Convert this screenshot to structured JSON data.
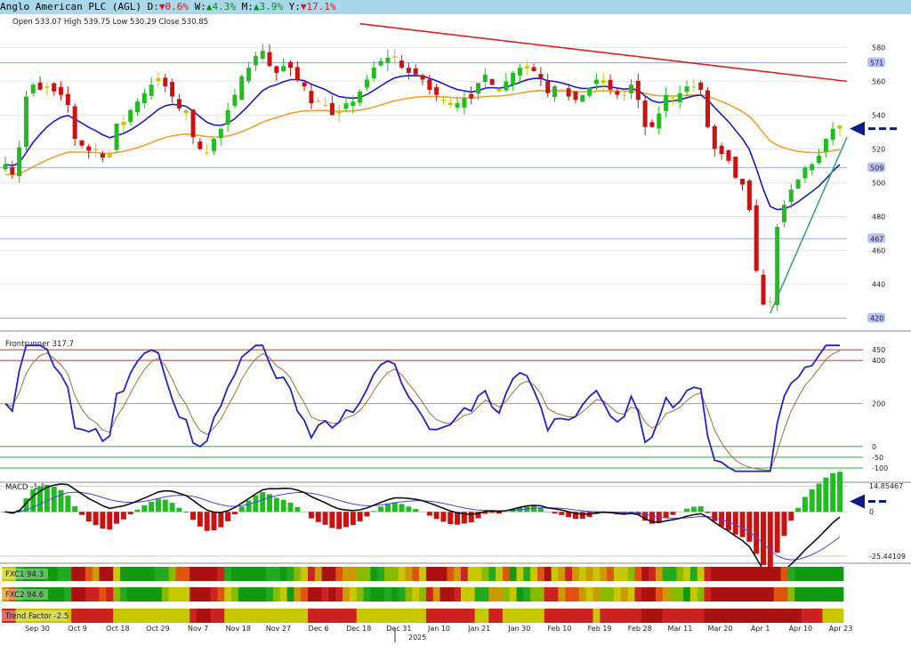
{
  "header": {
    "company": "Anglo American PLC (AGL)",
    "day_label": "D:",
    "day_value": "▼0.6%",
    "week_label": "W:",
    "week_value": "▲4.3%",
    "month_label": "M:",
    "month_value": "▲3.9%",
    "year_label": "Y:",
    "year_value": "▼17.1%"
  },
  "ohlc": "Open 533.07  High 539.75  Low 530.29  Close 530.85",
  "chart_data": {
    "type": "candlestick",
    "price_axis": {
      "ticks": [
        "580",
        "560",
        "540",
        "520",
        "500",
        "480",
        "460",
        "440",
        "420"
      ],
      "values": [
        580,
        560,
        540,
        520,
        500,
        480,
        460,
        440,
        420
      ],
      "ylim": [
        413,
        597
      ]
    },
    "horizontal_levels": [
      {
        "label": "571",
        "value": 571
      },
      {
        "label": "509",
        "value": 509
      },
      {
        "label": "467",
        "value": 467
      },
      {
        "label": "420",
        "value": 420
      }
    ],
    "x_axis_labels": [
      "Sep 30",
      "Oct 9",
      "Oct 18",
      "Oct 29",
      "Nov 7",
      "Nov 18",
      "Nov 27",
      "Dec 6",
      "Dec 18",
      "Dec 31",
      "Jan 10",
      "Jan 21",
      "Jan 30",
      "Feb 10",
      "Feb 19",
      "Feb 28",
      "Mar 11",
      "Mar 20",
      "Apr 1",
      "Apr 10",
      "Apr 23"
    ],
    "year_label": "2025",
    "candles_close": [
      511,
      505,
      521,
      551,
      558,
      555,
      557,
      554,
      552,
      546,
      526,
      522,
      519,
      520,
      515,
      517,
      535,
      536,
      543,
      548,
      553,
      558,
      562,
      557,
      551,
      544,
      541,
      527,
      520,
      518,
      526,
      532,
      543,
      552,
      563,
      568,
      575,
      578,
      569,
      565,
      569,
      568,
      561,
      557,
      547,
      548,
      546,
      540,
      541,
      547,
      548,
      554,
      561,
      568,
      572,
      574,
      574,
      568,
      565,
      564,
      561,
      555,
      552,
      549,
      546,
      547,
      550,
      550,
      559,
      564,
      558,
      554,
      560,
      565,
      568,
      569,
      566,
      562,
      553,
      557,
      555,
      551,
      549,
      552,
      556,
      561,
      559,
      555,
      552,
      552,
      558,
      549,
      533,
      533,
      541,
      552,
      550,
      553,
      557,
      557,
      555,
      533,
      520,
      517,
      513,
      503,
      499,
      484,
      448,
      428,
      430,
      474,
      487,
      496,
      502,
      509,
      511,
      516,
      526,
      532,
      532
    ],
    "ma_blue": {
      "name": "",
      "values_hint": "declining into late April"
    },
    "ma_orange": {
      "name": "",
      "values_hint": "slow rising average"
    },
    "trendlines": [
      "resistance from Jan 21 to Apr 23",
      "support from Apr 7 to Apr 23"
    ],
    "last_price_marker": "530.85",
    "frontrunner": {
      "label": "Frontrunner 317.7",
      "ticks": [
        "450",
        "400",
        "200",
        "0",
        "-50",
        "-100"
      ],
      "values": [
        450,
        400,
        200,
        0,
        -50,
        -100
      ],
      "ylim": [
        -125,
        500
      ]
    },
    "macd": {
      "label": "MACD -1.1",
      "ticks": [
        "14.85467",
        "0",
        "-25.44109"
      ],
      "values": [
        14.85467,
        0,
        -25.44109
      ]
    },
    "heat_strips": [
      {
        "label": "FXC1 94.3"
      },
      {
        "label": "FXC2 94.6"
      },
      {
        "label": "Trend Factor -2.5"
      }
    ]
  },
  "colors": {
    "up": "#22bb22",
    "down": "#cc1111",
    "neutral": "#c8c800",
    "ma_blue": "#1a1acc",
    "ma_orange": "#f2a02a",
    "resistance": "#e02020",
    "support": "#40a080",
    "arrow": "#0a1a8a"
  }
}
